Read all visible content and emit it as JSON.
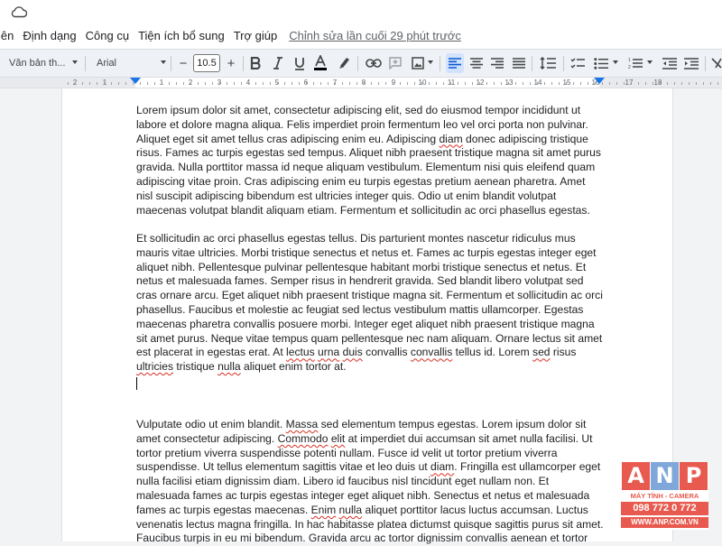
{
  "menu": {
    "items": [
      "iên",
      "Định dạng",
      "Công cụ",
      "Tiện ích bổ sung",
      "Trợ giúp"
    ],
    "last_edit": "Chỉnh sửa lần cuối 29 phút trước"
  },
  "toolbar": {
    "style": "Văn bản th...",
    "font": "Arial",
    "font_size": "10.5",
    "decrease": "−",
    "increase": "+"
  },
  "ruler": {
    "labels": [
      "2",
      "1",
      "1",
      "2",
      "3",
      "4",
      "5",
      "6",
      "7",
      "8",
      "9",
      "10",
      "11",
      "12",
      "13",
      "14",
      "15",
      "16",
      "17",
      "18"
    ]
  },
  "document": {
    "paragraphs": [
      {
        "lines": [
          [
            {
              "t": "Lorem ipsum dolor sit amet, consectetur adipiscing elit, sed do eiusmod tempor incididunt ut"
            }
          ],
          [
            {
              "t": "labore et dolore magna aliqua. Felis imperdiet proin fermentum leo vel orci porta non pulvinar."
            }
          ],
          [
            {
              "t": "Aliquet eget sit amet tellus cras adipiscing enim eu. Adipiscing "
            },
            {
              "t": "diam",
              "sq": true
            },
            {
              "t": " donec adipiscing tristique"
            }
          ],
          [
            {
              "t": "risus. Fames ac turpis egestas sed tempus. Aliquet nibh praesent tristique magna sit amet purus"
            }
          ],
          [
            {
              "t": "gravida. Nulla porttitor massa id neque aliquam vestibulum. Elementum nisi quis eleifend quam"
            }
          ],
          [
            {
              "t": "adipiscing vitae proin. Cras adipiscing enim eu turpis egestas pretium aenean pharetra. Amet"
            }
          ],
          [
            {
              "t": "nisl suscipit adipiscing bibendum est ultricies integer quis. Odio ut enim blandit volutpat"
            }
          ],
          [
            {
              "t": "maecenas volutpat blandit aliquam etiam. Fermentum et sollicitudin ac orci phasellus egestas."
            }
          ]
        ]
      },
      {
        "lines": [
          [
            {
              "t": "Et sollicitudin ac orci phasellus egestas tellus. Dis parturient montes nascetur ridiculus mus"
            }
          ],
          [
            {
              "t": "mauris vitae ultricies. Morbi tristique senectus et netus et. Fames ac turpis egestas integer eget"
            }
          ],
          [
            {
              "t": "aliquet nibh. Pellentesque pulvinar pellentesque habitant morbi tristique senectus et netus. Et"
            }
          ],
          [
            {
              "t": "netus et malesuada fames. Semper risus in hendrerit gravida. Sed blandit libero volutpat sed"
            }
          ],
          [
            {
              "t": "cras ornare arcu. Eget aliquet nibh praesent tristique magna sit. Fermentum et sollicitudin ac orci"
            }
          ],
          [
            {
              "t": "phasellus. Faucibus et molestie ac feugiat sed lectus vestibulum mattis ullamcorper. Egestas"
            }
          ],
          [
            {
              "t": "maecenas pharetra convallis posuere morbi. Integer eget aliquet nibh praesent tristique magna"
            }
          ],
          [
            {
              "t": "sit amet purus. Neque vitae tempus quam pellentesque nec nam aliquam. Ornare lectus sit amet"
            }
          ],
          [
            {
              "t": "est placerat in egestas erat. At "
            },
            {
              "t": "lectus",
              "sq": true
            },
            {
              "t": " "
            },
            {
              "t": "urna",
              "sq": true
            },
            {
              "t": " "
            },
            {
              "t": "duis",
              "sq": true
            },
            {
              "t": " convallis "
            },
            {
              "t": "convallis",
              "sq": true
            },
            {
              "t": " tellus id. Lorem "
            },
            {
              "t": "sed",
              "sq": true
            },
            {
              "t": " risus"
            }
          ],
          [
            {
              "t": "ultricies",
              "sq": true
            },
            {
              "t": " tristique "
            },
            {
              "t": "nulla",
              "sq": true
            },
            {
              "t": " aliquet enim tortor at."
            }
          ]
        ]
      },
      {
        "lines": [
          [
            {
              "t": "Vulputate odio ut enim blandit. "
            },
            {
              "t": "Massa",
              "sq": true
            },
            {
              "t": " sed elementum tempus egestas. Lorem ipsum dolor sit"
            }
          ],
          [
            {
              "t": "amet consectetur adipiscing. "
            },
            {
              "t": "Commodo",
              "sq": true
            },
            {
              "t": " "
            },
            {
              "t": "elit",
              "sq": true
            },
            {
              "t": " at imperdiet dui accumsan sit amet nulla facilisi. Ut"
            }
          ],
          [
            {
              "t": "tortor pretium viverra suspendisse potenti nullam. Fusce id velit ut tortor pretium viverra"
            }
          ],
          [
            {
              "t": "suspendisse. Ut tellus elementum sagittis vitae et leo duis ut "
            },
            {
              "t": "diam",
              "sq": true
            },
            {
              "t": ". Fringilla est ullamcorper eget"
            }
          ],
          [
            {
              "t": "nulla facilisi etiam dignissim diam. Libero id faucibus nisl tincidunt eget nullam non. Et"
            }
          ],
          [
            {
              "t": "malesuada fames ac turpis egestas integer eget aliquet nibh. Senectus et netus et malesuada"
            }
          ],
          [
            {
              "t": "fames ac turpis egestas maecenas. "
            },
            {
              "t": "Enim",
              "sq": true
            },
            {
              "t": " "
            },
            {
              "t": "nulla",
              "sq": true
            },
            {
              "t": " aliquet porttitor lacus luctus accumsan. Luctus"
            }
          ],
          [
            {
              "t": "venenatis lectus magna fringilla. In hac habitasse platea dictumst quisque sagittis purus sit amet."
            }
          ],
          [
            {
              "t": "Faucibus turpis in eu mi bibendum. Gravida arcu ac tortor dignissim convallis aenean et tortor"
            }
          ]
        ]
      }
    ]
  },
  "watermark": {
    "letters": [
      "A",
      "N",
      "P"
    ],
    "subtitle": "MÁY TÍNH - CAMERA",
    "phone": "098 772 0 772",
    "website": "WWW.ANP.COM.VN",
    "colors": {
      "A": "#e85a4f",
      "N": "#7fa7d9",
      "P": "#e85a4f"
    }
  },
  "colors": {
    "accent": "#1a73e8",
    "toolbar_bg": "#eef1f6",
    "spell_error": "#d93025"
  }
}
